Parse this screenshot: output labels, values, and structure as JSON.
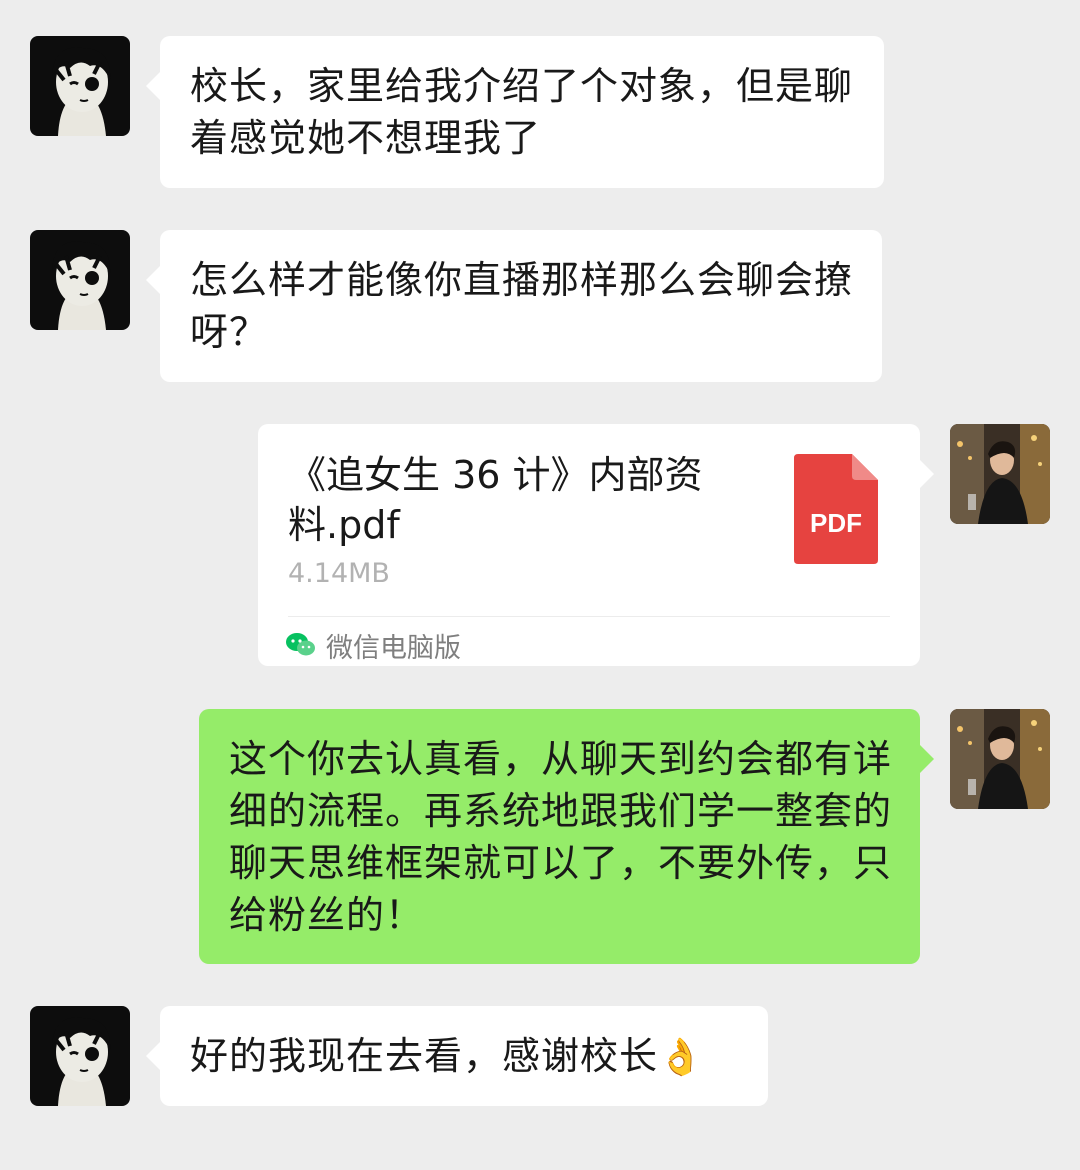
{
  "messages": {
    "m1": {
      "text": "校长，家里给我介绍了个对象，但是聊着感觉她不想理我了"
    },
    "m2": {
      "text": "怎么样才能像你直播那样那么会聊会撩呀？"
    },
    "file": {
      "name": "《追女生 36 计》内部资料.pdf",
      "size": "4.14MB",
      "source": "微信电脑版",
      "type_label": "PDF"
    },
    "m4": {
      "text": "这个你去认真看，从聊天到约会都有详细的流程。再系统地跟我们学一整套的聊天思维框架就可以了，不要外传，只给粉丝的！"
    },
    "m5": {
      "text": "好的我现在去看，感谢校长",
      "emoji": "👌"
    }
  },
  "colors": {
    "background": "#ededed",
    "incoming_bubble": "#ffffff",
    "outgoing_bubble": "#95ec69",
    "pdf_icon": "#e64340",
    "wechat_green": "#07c160"
  },
  "icons": {
    "contact_avatar": "cartoon-boy-avatar",
    "self_avatar": "photo-avatar",
    "file_type": "pdf-icon",
    "source": "wechat-icon"
  }
}
